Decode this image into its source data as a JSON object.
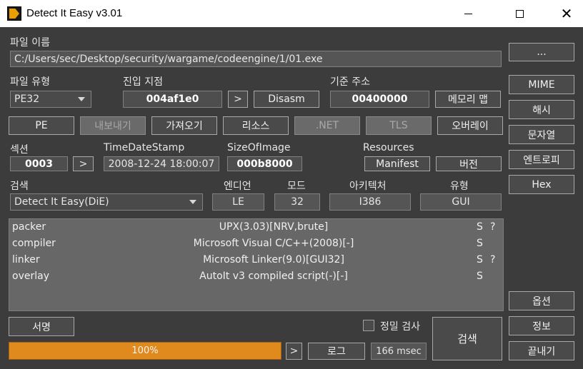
{
  "window": {
    "title": "Detect It Easy v3.01"
  },
  "file": {
    "label": "파일 이름",
    "path": "C:/Users/sec/Desktop/security/wargame/codeengine/1/01.exe",
    "browse_label": "..."
  },
  "file_type": {
    "label": "파일 유형",
    "value": "PE32"
  },
  "entry_point": {
    "label": "진입 지점",
    "value": "004af1e0",
    "arrow": ">",
    "disasm_label": "Disasm"
  },
  "base_address": {
    "label": "기준 주소",
    "value": "00400000",
    "memory_map_label": "메모리 맵"
  },
  "side": {
    "mime": "MIME",
    "hash": "해시",
    "strings": "문자열",
    "entropy": "엔트로피",
    "hex": "Hex",
    "options": "옵션",
    "about": "정보",
    "exit": "끝내기"
  },
  "tabs": {
    "pe": "PE",
    "export": "내보내기",
    "import": "가져오기",
    "resources": "리소스",
    "net": ".NET",
    "tls": "TLS",
    "overlay": "오버레이"
  },
  "sections": {
    "label": "섹션",
    "value": "0003",
    "arrow": ">"
  },
  "timestamp": {
    "label": "TimeDateStamp",
    "value": "2008-12-24 18:00:07"
  },
  "size_of_image": {
    "label": "SizeOfImage",
    "value": "000b8000"
  },
  "resources": {
    "label": "Resources",
    "manifest": "Manifest",
    "version": "버전"
  },
  "scan": {
    "label": "검색",
    "engine": "Detect It Easy(DiE)",
    "endian_label": "엔디언",
    "endian": "LE",
    "mode_label": "모드",
    "mode": "32",
    "arch_label": "아키텍처",
    "arch": "I386",
    "type_label": "유형",
    "type": "GUI"
  },
  "results": [
    {
      "type": "packer",
      "name": "UPX(3.03)[NRV,brute]",
      "s": "S",
      "q": "?"
    },
    {
      "type": "compiler",
      "name": "Microsoft Visual C/C++(2008)[-]",
      "s": "S",
      "q": ""
    },
    {
      "type": "linker",
      "name": "Microsoft Linker(9.0)[GUI32]",
      "s": "S",
      "q": "?"
    },
    {
      "type": "overlay",
      "name": "AutoIt v3 compiled script(-)[-]",
      "s": "S",
      "q": ""
    }
  ],
  "bottom": {
    "signatures_label": "서명",
    "deep_scan_label": "정밀 검사",
    "progress_text": "100%",
    "progress_value": 1.0,
    "progress_arrow": ">",
    "log_label": "로그",
    "elapsed": "166 msec",
    "scan_button": "검색"
  },
  "colors": {
    "background": "#3c3c3c",
    "progress": "#e08a1e",
    "results_bg": "#676767"
  },
  "icons": {
    "app": "die-app-icon",
    "minimize": "minimize-icon",
    "maximize": "maximize-icon",
    "close": "close-icon",
    "dropdown": "chevron-down-icon",
    "checkbox": "checkbox-unchecked"
  }
}
